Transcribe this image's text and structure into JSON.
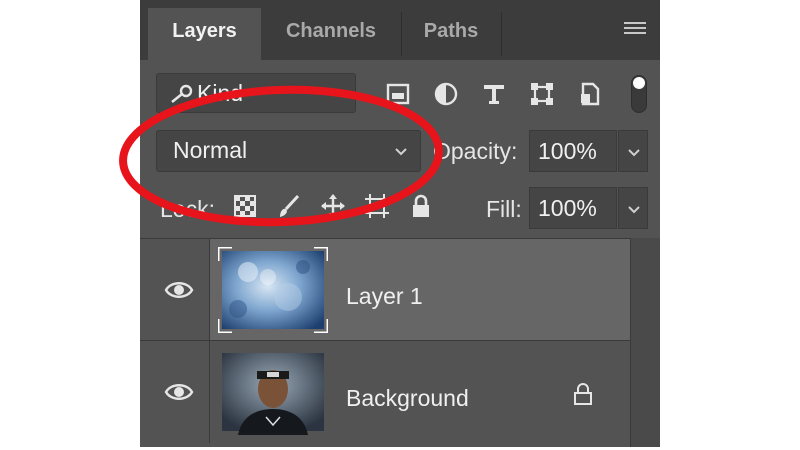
{
  "tabs": [
    {
      "label": "Layers",
      "active": true
    },
    {
      "label": "Channels",
      "active": false
    },
    {
      "label": "Paths",
      "active": false
    }
  ],
  "filter": {
    "kind_label": "Kind"
  },
  "blend": {
    "mode": "Normal"
  },
  "opacity": {
    "label": "Opacity:",
    "value": "100%"
  },
  "lock": {
    "label": "Lock:"
  },
  "fill": {
    "label": "Fill:",
    "value": "100%"
  },
  "layers": [
    {
      "name": "Layer 1",
      "selected": true,
      "visible": true,
      "locked": false
    },
    {
      "name": "Background",
      "selected": false,
      "visible": true,
      "locked": true
    }
  ],
  "icons": {
    "panel_menu": "hamburger-icon",
    "filter": [
      "image-filter-icon",
      "adjustment-filter-icon",
      "type-filter-icon",
      "shape-filter-icon",
      "smart-object-filter-icon"
    ],
    "lock": [
      "lock-transparent-pixels-icon",
      "lock-image-pixels-icon",
      "lock-position-icon",
      "lock-artboard-icon",
      "lock-all-icon"
    ]
  },
  "colors": {
    "panel_bg": "#535353",
    "tabbar_bg": "#3c3c3c",
    "field_bg": "#454545",
    "selected_row": "#666666",
    "annotation": "#e8141b"
  }
}
